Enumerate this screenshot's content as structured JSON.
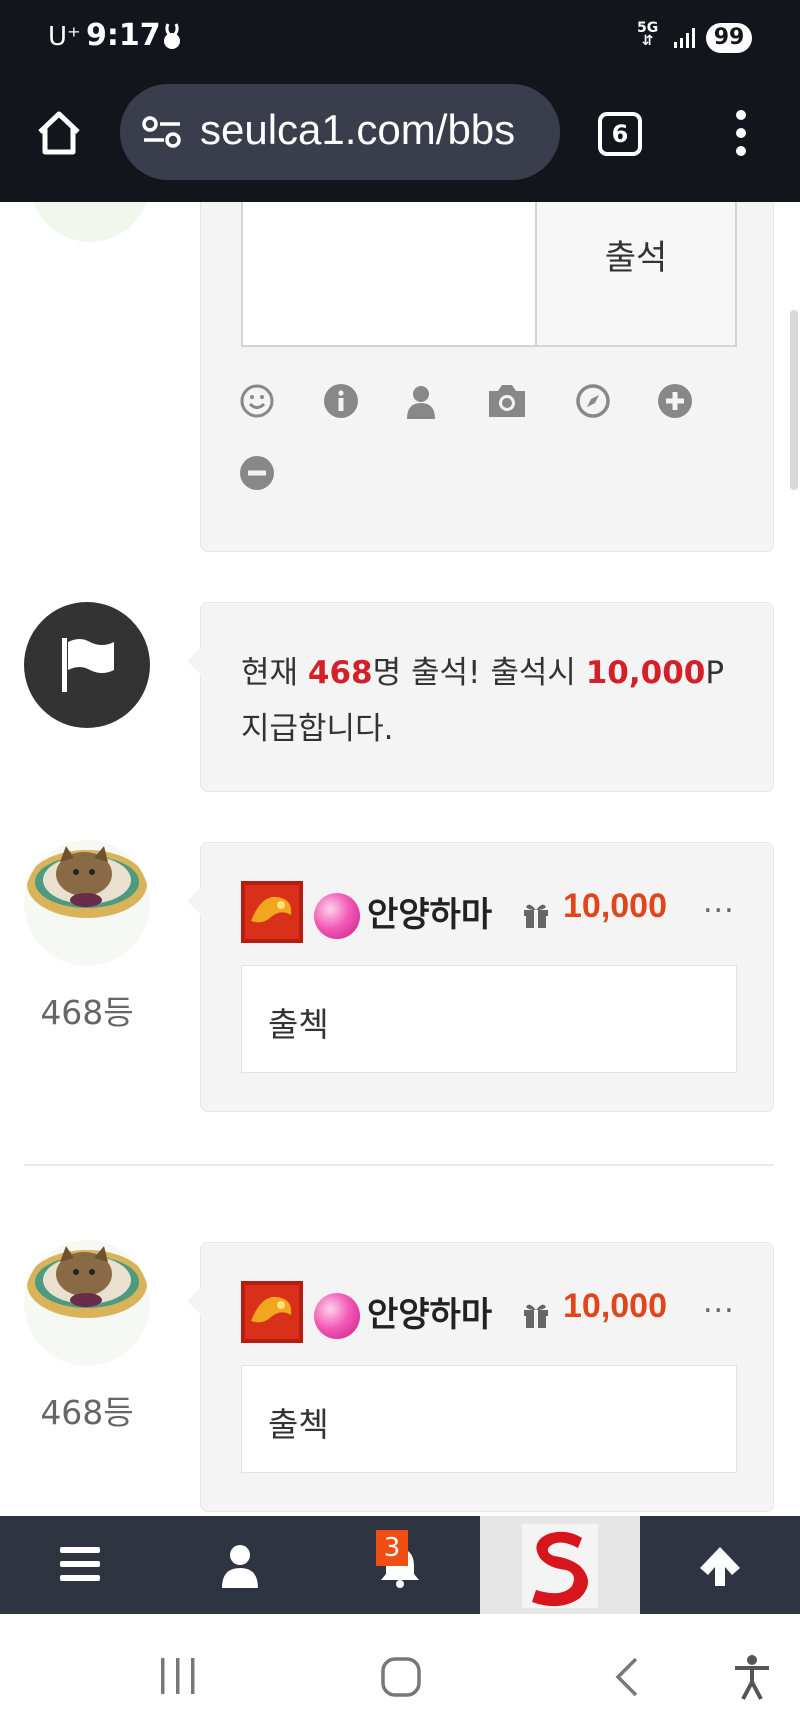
{
  "status_bar": {
    "carrier": "U⁺",
    "time": "9:17",
    "network": "5G",
    "battery": "99"
  },
  "browser": {
    "url": "seulca1.com/bbs",
    "tab_count": "6"
  },
  "write_form": {
    "submit_label": "출석",
    "tools": [
      "smile-icon",
      "info-icon",
      "user-icon",
      "camera-icon",
      "compass-icon",
      "plus-icon",
      "minus-icon"
    ]
  },
  "notice": {
    "prefix": "현재 ",
    "count": "468",
    "middle": "명 출석! 출석시 ",
    "points": "10,000",
    "suffix": "P 지급합니다."
  },
  "comments": [
    {
      "rank": "468등",
      "nickname": "안양하마",
      "points": "10,000",
      "more": "...",
      "text": "출첵"
    },
    {
      "rank": "468등",
      "nickname": "안양하마",
      "points": "10,000",
      "more": "...",
      "text": "출첵"
    }
  ],
  "bottom_nav": {
    "notification_count": "3",
    "items": [
      "menu-icon",
      "user-icon",
      "bell-icon",
      "site-logo",
      "arrow-up-icon"
    ]
  },
  "colors": {
    "chrome_bg": "#13151c",
    "highlight_red": "#d32029",
    "points_orange": "#e0451c",
    "nav_bg": "#2e3440",
    "badge": "#f04e12"
  }
}
